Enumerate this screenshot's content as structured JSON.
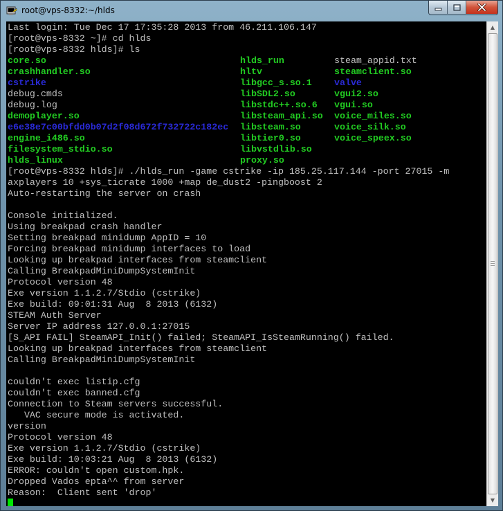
{
  "window": {
    "title": "root@vps-8332:~/hlds",
    "icon": "putty-terminal-icon",
    "colors": {
      "frame": "#7a9bb2",
      "close": "#c5311c"
    }
  },
  "terminal": {
    "colors": {
      "background": "#000000",
      "text": "#c0c0c0",
      "executable": "#22cc22",
      "directory": "#2a2ad8",
      "cursor": "#00e600"
    },
    "pre_lines": [
      "Last login: Tue Dec 17 17:35:28 2013 from 46.211.106.147",
      "[root@vps-8332 ~]# cd hlds",
      "[root@vps-8332 hlds]# ls"
    ],
    "ls_rows": [
      [
        {
          "text": "core.so",
          "type": "exe"
        },
        {
          "text": "hlds_run",
          "type": "exe"
        },
        {
          "text": "steam_appid.txt",
          "type": "file"
        }
      ],
      [
        {
          "text": "crashhandler.so",
          "type": "exe"
        },
        {
          "text": "hltv",
          "type": "exe"
        },
        {
          "text": "steamclient.so",
          "type": "exe"
        }
      ],
      [
        {
          "text": "cstrike",
          "type": "dir"
        },
        {
          "text": "libgcc_s.so.1",
          "type": "exe"
        },
        {
          "text": "valve",
          "type": "dir"
        }
      ],
      [
        {
          "text": "debug.cmds",
          "type": "file"
        },
        {
          "text": "libSDL2.so",
          "type": "exe"
        },
        {
          "text": "vgui2.so",
          "type": "exe"
        }
      ],
      [
        {
          "text": "debug.log",
          "type": "file"
        },
        {
          "text": "libstdc++.so.6",
          "type": "exe"
        },
        {
          "text": "vgui.so",
          "type": "exe"
        }
      ],
      [
        {
          "text": "demoplayer.so",
          "type": "exe"
        },
        {
          "text": "libsteam_api.so",
          "type": "exe"
        },
        {
          "text": "voice_miles.so",
          "type": "exe"
        }
      ],
      [
        {
          "text": "e6e38e7c00bfdd0b07d2f08d672f732722c182ec",
          "type": "dir"
        },
        {
          "text": "libsteam.so",
          "type": "exe"
        },
        {
          "text": "voice_silk.so",
          "type": "exe"
        }
      ],
      [
        {
          "text": "engine_i486.so",
          "type": "exe"
        },
        {
          "text": "libtier0.so",
          "type": "exe"
        },
        {
          "text": "voice_speex.so",
          "type": "exe"
        }
      ],
      [
        {
          "text": "filesystem_stdio.so",
          "type": "exe"
        },
        {
          "text": "libvstdlib.so",
          "type": "exe"
        },
        {
          "text": "",
          "type": "file"
        }
      ],
      [
        {
          "text": "hlds_linux",
          "type": "exe"
        },
        {
          "text": "proxy.so",
          "type": "exe"
        },
        {
          "text": "",
          "type": "file"
        }
      ]
    ],
    "post_lines": [
      "[root@vps-8332 hlds]# ./hlds_run -game cstrike -ip 185.25.117.144 -port 27015 -m",
      "axplayers 10 +sys_ticrate 1000 +map de_dust2 -pingboost 2",
      "Auto-restarting the server on crash",
      "",
      "Console initialized.",
      "Using breakpad crash handler",
      "Setting breakpad minidump AppID = 10",
      "Forcing breakpad minidump interfaces to load",
      "Looking up breakpad interfaces from steamclient",
      "Calling BreakpadMiniDumpSystemInit",
      "Protocol version 48",
      "Exe version 1.1.2.7/Stdio (cstrike)",
      "Exe build: 09:01:31 Aug  8 2013 (6132)",
      "STEAM Auth Server",
      "Server IP address 127.0.0.1:27015",
      "[S_API FAIL] SteamAPI_Init() failed; SteamAPI_IsSteamRunning() failed.",
      "Looking up breakpad interfaces from steamclient",
      "Calling BreakpadMiniDumpSystemInit",
      "",
      "couldn't exec listip.cfg",
      "couldn't exec banned.cfg",
      "Connection to Steam servers successful.",
      "   VAC secure mode is activated.",
      "version",
      "Protocol version 48",
      "Exe version 1.1.2.7/Stdio (cstrike)",
      "Exe build: 10:03:21 Aug  8 2013 (6132)",
      "ERROR: couldn't open custom.hpk.",
      "Dropped Vados epta^^ from server",
      "Reason:  Client sent 'drop'"
    ]
  }
}
